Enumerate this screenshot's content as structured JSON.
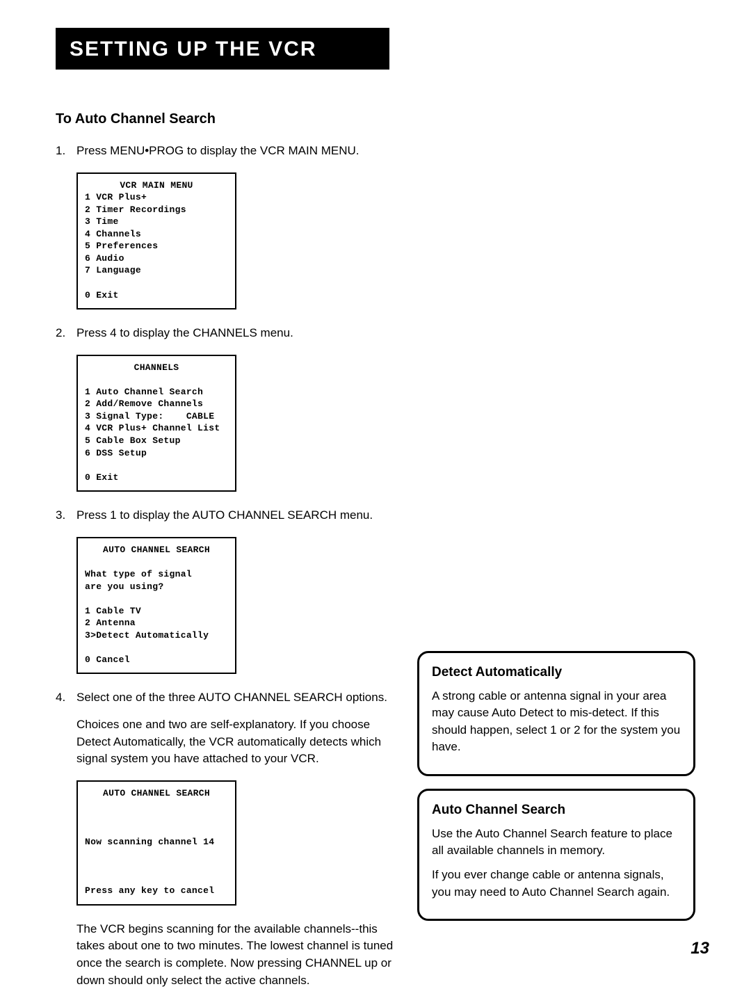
{
  "header": "SETTING UP THE VCR",
  "section_title": "To Auto Channel Search",
  "steps": {
    "s1_num": "1.",
    "s1_text": "Press MENU•PROG to display the VCR MAIN MENU.",
    "s2_num": "2.",
    "s2_text": "Press 4 to display the CHANNELS menu.",
    "s3_num": "3.",
    "s3_text": "Press 1 to display the AUTO CHANNEL SEARCH menu.",
    "s4_num": "4.",
    "s4_text": "Select one of the three AUTO CHANNEL SEARCH options.",
    "s4_para1": "Choices one and two are self-explanatory. If you choose Detect Automatically, the VCR automatically detects which signal system you have attached to your VCR.",
    "s4_para2": "The VCR begins scanning for the available channels--this takes about one to two minutes. The lowest channel is tuned once the search is complete. Now pressing CHANNEL up or down should only select the active channels."
  },
  "screen_main": {
    "title": "VCR MAIN MENU",
    "l1": "1 VCR Plus+",
    "l2": "2 Timer Recordings",
    "l3": "3 Time",
    "l4": "4 Channels",
    "l5": "5 Preferences",
    "l6": "6 Audio",
    "l7": "7 Language",
    "l0": "0 Exit"
  },
  "screen_channels": {
    "title": "CHANNELS",
    "l1": "1 Auto Channel Search",
    "l2": "2 Add/Remove Channels",
    "l3": "3 Signal Type:    CABLE",
    "l4": "4 VCR Plus+ Channel List",
    "l5": "5 Cable Box Setup",
    "l6": "6 DSS Setup",
    "l0": "0 Exit"
  },
  "screen_auto": {
    "title": "AUTO CHANNEL SEARCH",
    "prompt1": "What type of signal",
    "prompt2": "are you using?",
    "l1": "1 Cable TV",
    "l2": "2 Antenna",
    "l3": "3>Detect Automatically",
    "l0": "0 Cancel"
  },
  "screen_scan": {
    "title": "AUTO CHANNEL SEARCH",
    "status": "Now scanning channel 14",
    "cancel": "Press any key to cancel"
  },
  "callout1": {
    "title": "Detect Automatically",
    "text": "A strong cable or antenna signal in your area may cause Auto Detect to mis-detect. If this should happen, select 1 or 2 for the system you have."
  },
  "callout2": {
    "title": "Auto Channel Search",
    "text1": "Use the Auto Channel Search feature to place all available channels in memory.",
    "text2": "If you ever change cable or antenna signals, you may need to Auto Channel Search again."
  },
  "page_number": "13"
}
